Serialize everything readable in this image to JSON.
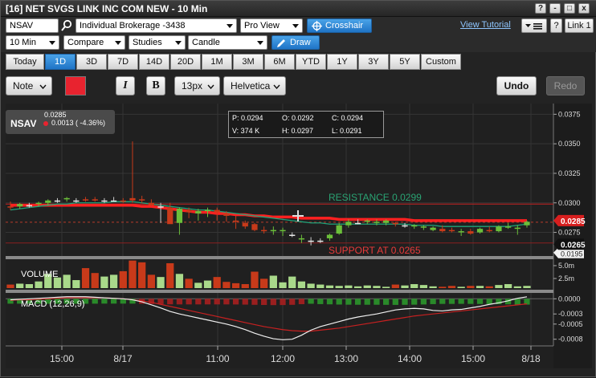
{
  "window": {
    "title": "[16] NET SVGS LINK INC COM NEW - 10 Min",
    "controls": [
      "?",
      "-",
      "□",
      "x"
    ]
  },
  "toolbar1": {
    "symbol": "NSAV",
    "account": "Individual Brokerage -3438",
    "view": "Pro View",
    "crosshair_label": "Crosshair",
    "tutorial_label": "View Tutorial",
    "help_label": "?",
    "link_label": "Link 1"
  },
  "toolbar2": {
    "interval": "10 Min",
    "compare": "Compare",
    "studies": "Studies",
    "chart_type": "Candle",
    "draw_label": "Draw"
  },
  "ranges": [
    "Today",
    "1D",
    "3D",
    "7D",
    "14D",
    "20D",
    "1M",
    "3M",
    "6M",
    "YTD",
    "1Y",
    "3Y",
    "5Y",
    "Custom"
  ],
  "active_range": "1D",
  "drawtools": {
    "note_label": "Note",
    "color": "#e8232f",
    "italic": "I",
    "bold": "B",
    "font_size": "13px",
    "font_family": "Helvetica",
    "undo": "Undo",
    "redo": "Redo"
  },
  "legend": {
    "symbol": "NSAV",
    "price": "0.0285",
    "change": "0.0013 ( -4.36%)"
  },
  "ohlc": {
    "p": "P: 0.0294",
    "o": "O: 0.0292",
    "c": "C: 0.0294",
    "v": "V: 374 K",
    "h": "H: 0.0297",
    "l": "L: 0.0291"
  },
  "annotations": {
    "resistance": "RESISTANCE 0.0299",
    "support": "SUPPORT AT 0.0265"
  },
  "price_axis": [
    "0.0375",
    "0.0350",
    "0.0325",
    "0.0300",
    "0.0275"
  ],
  "price_flags": {
    "last": "0.0285",
    "support": "0.0265",
    "hidden": "0.0195"
  },
  "volume": {
    "label": "VOLUME",
    "axis": [
      "5.0m",
      "2.5m"
    ]
  },
  "macd": {
    "label": "MACD (12,26,9)",
    "axis": [
      "0.0000",
      "-0.0003",
      "-0.0005",
      "-0.0008"
    ]
  },
  "time_axis": [
    "15:00",
    "8/17",
    "11:00",
    "12:00",
    "13:00",
    "14:00",
    "15:00",
    "8/18"
  ],
  "colors": {
    "up": "#6bbf3a",
    "down": "#c83a1a",
    "ma": "#1fa37a",
    "resistance": "#ff2020",
    "support_text": "#e83a3a"
  },
  "chart_data": {
    "type": "candlestick",
    "interval": "10 Min",
    "x": [
      "15:00",
      "8/17",
      "11:00",
      "12:00",
      "13:00",
      "14:00",
      "15:00",
      "8/18"
    ],
    "price_range": [
      0.0255,
      0.038
    ],
    "candles": [
      [
        0.0297,
        0.0301,
        0.0294,
        0.0296
      ],
      [
        0.0297,
        0.03,
        0.0295,
        0.0299
      ],
      [
        0.0298,
        0.03,
        0.0296,
        0.0298
      ],
      [
        0.0299,
        0.0301,
        0.0297,
        0.03
      ],
      [
        0.03,
        0.0303,
        0.0298,
        0.0302
      ],
      [
        0.0302,
        0.0304,
        0.03,
        0.0302
      ],
      [
        0.0303,
        0.0305,
        0.0301,
        0.0304
      ],
      [
        0.0302,
        0.0304,
        0.03,
        0.0302
      ],
      [
        0.0303,
        0.0305,
        0.0301,
        0.0302
      ],
      [
        0.0303,
        0.0305,
        0.0301,
        0.0302
      ],
      [
        0.0302,
        0.0304,
        0.03,
        0.0302
      ],
      [
        0.0302,
        0.0305,
        0.0301,
        0.0302
      ],
      [
        0.0302,
        0.0304,
        0.03,
        0.0301
      ],
      [
        0.0304,
        0.0352,
        0.03,
        0.0302
      ],
      [
        0.0303,
        0.0306,
        0.03,
        0.0302
      ],
      [
        0.03,
        0.0303,
        0.0297,
        0.0298
      ],
      [
        0.0297,
        0.03,
        0.0283,
        0.0297
      ],
      [
        0.0296,
        0.03,
        0.0284,
        0.0282
      ],
      [
        0.0283,
        0.0296,
        0.0273,
        0.0295
      ],
      [
        0.0294,
        0.0296,
        0.0287,
        0.0292
      ],
      [
        0.0291,
        0.0295,
        0.0285,
        0.0293
      ],
      [
        0.0293,
        0.0296,
        0.0288,
        0.0294
      ],
      [
        0.0294,
        0.0296,
        0.0285,
        0.0292
      ],
      [
        0.0291,
        0.0293,
        0.0284,
        0.0289
      ],
      [
        0.0285,
        0.0289,
        0.0278,
        0.0284
      ],
      [
        0.0283,
        0.0285,
        0.0278,
        0.028
      ],
      [
        0.0282,
        0.0283,
        0.0276,
        0.0277
      ],
      [
        0.0277,
        0.028,
        0.0274,
        0.0276
      ],
      [
        0.0276,
        0.028,
        0.0273,
        0.0277
      ],
      [
        0.0276,
        0.0279,
        0.0272,
        0.0277
      ],
      [
        0.0273,
        0.0275,
        0.0271,
        0.0273
      ],
      [
        0.0269,
        0.0273,
        0.0266,
        0.027
      ],
      [
        0.0268,
        0.0271,
        0.0264,
        0.0268
      ],
      [
        0.0268,
        0.027,
        0.0266,
        0.0268
      ],
      [
        0.027,
        0.0274,
        0.0268,
        0.0273
      ],
      [
        0.0274,
        0.0283,
        0.0273,
        0.0281
      ],
      [
        0.0281,
        0.0286,
        0.0279,
        0.0284
      ],
      [
        0.0283,
        0.0286,
        0.0282,
        0.0283
      ],
      [
        0.0284,
        0.0286,
        0.0282,
        0.0285
      ],
      [
        0.0283,
        0.0286,
        0.0281,
        0.0284
      ],
      [
        0.0283,
        0.0286,
        0.0281,
        0.0285
      ],
      [
        0.0283,
        0.0284,
        0.028,
        0.0282
      ],
      [
        0.0281,
        0.0283,
        0.0279,
        0.0281
      ],
      [
        0.028,
        0.0282,
        0.0278,
        0.0281
      ],
      [
        0.0279,
        0.0281,
        0.0277,
        0.028
      ],
      [
        0.0277,
        0.028,
        0.0276,
        0.0279
      ],
      [
        0.0278,
        0.0281,
        0.0275,
        0.0276
      ],
      [
        0.0277,
        0.0279,
        0.0275,
        0.0276
      ],
      [
        0.0275,
        0.0278,
        0.0272,
        0.0276
      ],
      [
        0.0276,
        0.0278,
        0.0273,
        0.0274
      ],
      [
        0.0275,
        0.0279,
        0.0274,
        0.0278
      ],
      [
        0.0277,
        0.028,
        0.0275,
        0.0276
      ],
      [
        0.0276,
        0.0281,
        0.0275,
        0.028
      ],
      [
        0.0279,
        0.0283,
        0.0278,
        0.028
      ],
      [
        0.0278,
        0.0281,
        0.0273,
        0.0279
      ],
      [
        0.0281,
        0.0285,
        0.0279,
        0.0284
      ]
    ],
    "moving_average": [
      0.0294,
      0.0295,
      0.0296,
      0.0297,
      0.0298,
      0.0299,
      0.0299,
      0.03,
      0.03,
      0.03,
      0.03,
      0.0301,
      0.0301,
      0.0301,
      0.03,
      0.0299,
      0.0298,
      0.0297,
      0.0296,
      0.0295,
      0.0294,
      0.0294,
      0.0293,
      0.0292,
      0.0291,
      0.029,
      0.0289,
      0.0288,
      0.0287,
      0.0286,
      0.0285,
      0.0284,
      0.0283,
      0.0283,
      0.0282,
      0.0282,
      0.0282,
      0.0282,
      0.0282,
      0.0282,
      0.0282,
      0.0282,
      0.0282,
      0.0281,
      0.0281,
      0.0281,
      0.028,
      0.028,
      0.028,
      0.028,
      0.028,
      0.028,
      0.028,
      0.028,
      0.0281,
      0.0282
    ],
    "resistance_line": [
      0.0298,
      0.0298,
      0.0298,
      0.0298,
      0.0298,
      0.0298,
      0.0298,
      0.0298,
      0.0298,
      0.0298,
      0.0298,
      0.0298,
      0.0298,
      0.0298,
      0.0297,
      0.0297,
      0.0296,
      0.0295,
      0.0294,
      0.0293,
      0.0292,
      0.0292,
      0.0291,
      0.0291,
      0.029,
      0.029,
      0.0289,
      0.0289,
      0.0288,
      0.0288,
      0.0288,
      0.0287,
      0.0287,
      0.0287,
      0.0287,
      0.0286,
      0.0286,
      0.0286,
      0.0286,
      0.0286,
      0.0286,
      0.0286,
      0.0286,
      0.0285,
      0.0285,
      0.0285,
      0.0285,
      0.0285,
      0.0285,
      0.0285,
      0.0285,
      0.0285,
      0.0285,
      0.0285,
      0.0285,
      0.0285
    ],
    "volume": [
      0.8,
      1.0,
      0.9,
      1.5,
      3.2,
      2.4,
      3.0,
      1.8,
      4.5,
      3.4,
      2.6,
      3.0,
      3.8,
      6.2,
      5.8,
      3.0,
      2.5,
      5.6,
      3.2,
      2.1,
      1.2,
      1.7,
      2.5,
      1.4,
      1.1,
      0.9,
      3.7,
      2.1,
      2.8,
      1.3,
      2.6,
      1.5,
      1.0,
      0.8,
      0.6,
      0.5,
      0.6,
      0.4,
      0.6,
      0.5,
      0.3,
      0.8,
      0.6,
      0.9,
      0.7,
      0.4,
      0.3,
      0.5,
      0.3,
      0.5,
      0.5,
      0.4,
      0.7,
      0.9,
      0.4,
      0.5
    ],
    "macd": [
      -2e-05,
      -1e-05,
      0.0,
      1e-05,
      2e-05,
      3e-05,
      4e-05,
      4e-05,
      4e-05,
      3e-05,
      2e-05,
      1e-05,
      0.0,
      -2e-05,
      -6e-05,
      -0.00012,
      -0.00018,
      -0.00025,
      -0.0003,
      -0.00034,
      -0.00038,
      -0.00042,
      -0.00046,
      -0.0005,
      -0.00055,
      -0.00061,
      -0.00068,
      -0.00074,
      -0.00079,
      -0.00081,
      -0.0008,
      -0.00072,
      -0.00062,
      -0.00055,
      -0.0005,
      -0.00045,
      -0.0004,
      -0.00036,
      -0.00033,
      -0.0003,
      -0.00026,
      -0.00022,
      -0.0002,
      -0.00019,
      -0.0002,
      -0.00023,
      -0.00024,
      -0.00022,
      -0.00021,
      -0.00018,
      -0.00015,
      -0.00011,
      -8e-05,
      -4e-05,
      1e-05,
      4e-05
    ],
    "macd_signal": [
      -3e-05,
      -2e-05,
      -2e-05,
      -1e-05,
      0.0,
      1e-05,
      2e-05,
      2e-05,
      2e-05,
      2e-05,
      2e-05,
      1e-05,
      0.0,
      -2e-05,
      -4e-05,
      -7e-05,
      -0.00011,
      -0.00015,
      -0.00019,
      -0.00023,
      -0.00027,
      -0.00031,
      -0.00035,
      -0.00039,
      -0.00043,
      -0.00047,
      -0.00051,
      -0.00055,
      -0.00058,
      -0.00061,
      -0.00063,
      -0.00064,
      -0.00064,
      -0.00062,
      -0.0006,
      -0.00058,
      -0.00055,
      -0.00052,
      -0.00049,
      -0.00046,
      -0.00043,
      -0.0004,
      -0.00037,
      -0.00034,
      -0.00032,
      -0.0003,
      -0.00028,
      -0.00026,
      -0.00024,
      -0.00022,
      -0.0002,
      -0.00018,
      -0.00016,
      -0.00014,
      -0.00012,
      -0.0001
    ],
    "macd_range": [
      -0.0009,
      0.0001
    ]
  }
}
